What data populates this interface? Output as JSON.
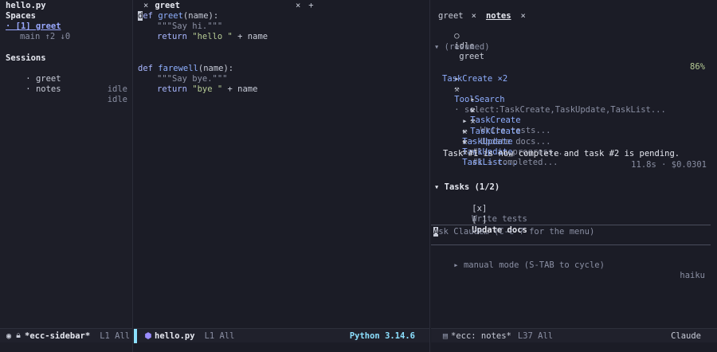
{
  "sidebar": {
    "tab_title": "hello.py",
    "spaces_heading": "Spaces",
    "space_item": "· [1] greet",
    "space_branch": "main ↑2 ↓0",
    "sessions_heading": "Sessions",
    "sessions": [
      {
        "name": "· greet",
        "status": "idle"
      },
      {
        "name": "· notes",
        "status": "idle"
      }
    ],
    "modeline": {
      "name": "*ecc-sidebar*",
      "pos": "L1 All"
    }
  },
  "editor": {
    "tab_close": "×",
    "tab_title": "greet",
    "tab_close2": "×",
    "tab_add": "+",
    "code": [
      {
        "kw": "def",
        "fn": "greet",
        "rest": "(name):"
      },
      {
        "doc": "\"\"\"Say hi.\"\"\""
      },
      {
        "kw": "return",
        "str": "\"hello \"",
        "rest": " + name"
      },
      {
        "blank": true
      },
      {
        "blank": true
      },
      {
        "kw": "def",
        "fn": "farewell",
        "rest": "(name):"
      },
      {
        "doc": "\"\"\"Say bye.\"\"\""
      },
      {
        "kw": "return",
        "str": "\"bye \"",
        "rest": " + name"
      }
    ],
    "modeline": {
      "name": "hello.py",
      "pos": "L1 All",
      "lang": "Python 3.14.6"
    }
  },
  "chat": {
    "tabs": [
      {
        "label": "greet",
        "close": "×"
      },
      {
        "label": "notes",
        "close": "×"
      }
    ],
    "status": {
      "state": "idle",
      "session": "greet",
      "percent": "86%"
    },
    "resumed": "▾ (resumed)",
    "tool_search": {
      "name": "ToolSearch",
      "detail": "· select:TaskCreate,TaskUpdate,TaskList..."
    },
    "task_create_group": "TaskCreate ×2",
    "task_creates": [
      {
        "name": "TaskCreate",
        "detail": "· Write tests..."
      },
      {
        "name": "TaskCreate",
        "detail": "· Update docs..."
      }
    ],
    "task_updates": [
      {
        "name": "TaskUpdate",
        "detail": "· #1 → in_progress..."
      },
      {
        "name": "TaskUpdate",
        "detail": "· #1 → completed..."
      }
    ],
    "task_list": {
      "name": "TaskList..."
    },
    "message": "Task #1 is now complete and task #2 is pending.",
    "meta": "11.8s · $0.0301",
    "tasks_heading": "▾ Tasks (1/2)",
    "tasks": [
      {
        "box": "[x]",
        "label": "Write tests"
      },
      {
        "box": "[ ]",
        "label": "Update docs"
      }
    ],
    "input_cursor": "A",
    "input_placeholder": "sk Claude… (C-c ? for the menu)",
    "mode_hint": "▸ manual mode (S-TAB to cycle)",
    "model": "haiku",
    "modeline": {
      "name": "*ecc: notes*",
      "pos": "L37 All",
      "backend": "Claude"
    }
  }
}
